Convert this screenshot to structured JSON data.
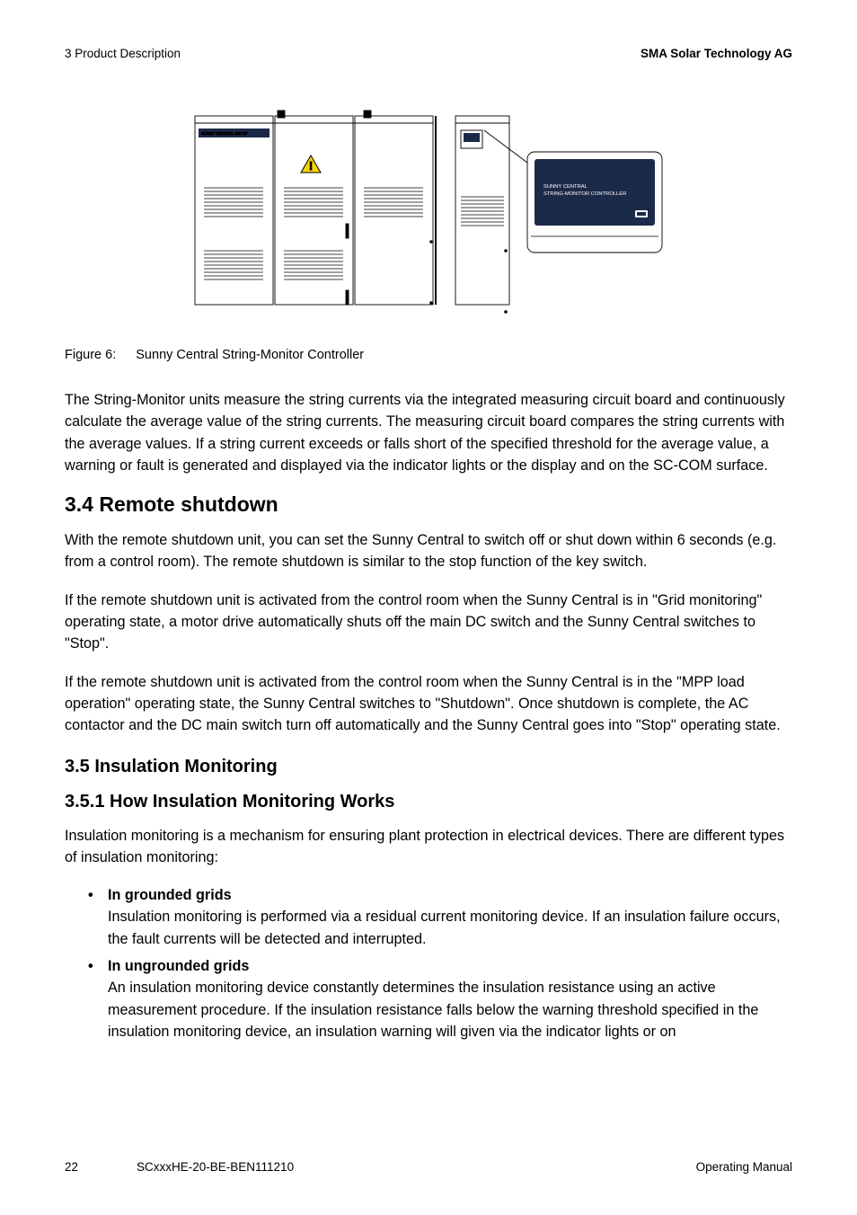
{
  "header": {
    "left": "3  Product Description",
    "right": "SMA Solar Technology AG"
  },
  "figure": {
    "cab_label": "SUNNY CENTRAL 800 CP",
    "ctrl_line1": "SUNNY CENTRAL",
    "ctrl_line2": "STRING-MONITOR CONTROLLER",
    "caption_label": "Figure 6:",
    "caption_text": "Sunny Central String-Monitor Controller"
  },
  "paragraphs": {
    "p1": "The String-Monitor units measure the string currents via the integrated measuring circuit board and continuously calculate the average value of the string currents. The measuring circuit board compares the string currents with the average values. If a string current exceeds or falls short of the specified threshold for the average value, a warning or fault is generated and displayed via the indicator lights or the display and on the SC-COM surface.",
    "p2": "With the remote shutdown unit, you can set the Sunny Central to switch off or shut down within 6 seconds (e.g. from a control room). The remote shutdown is similar to the stop function of the key switch.",
    "p3": "If the remote shutdown unit is activated from the control room when the Sunny Central is in \"Grid monitoring\" operating state, a motor drive automatically shuts off the main DC switch and the Sunny Central switches to \"Stop\".",
    "p4": "If the remote shutdown unit is activated from the control room when the Sunny Central is in the \"MPP load operation\" operating state, the Sunny Central switches to \"Shutdown\". Once shutdown is complete, the AC contactor and the DC main switch turn off automatically and the Sunny Central goes into \"Stop\" operating state.",
    "p5": "Insulation monitoring is a mechanism for ensuring plant protection in electrical devices. There are different types of insulation monitoring:"
  },
  "headings": {
    "h34": "3.4  Remote shutdown",
    "h35": "3.5  Insulation Monitoring",
    "h351": "3.5.1  How Insulation Monitoring Works"
  },
  "bullets": {
    "b1_title": "In grounded grids",
    "b1_body": "Insulation monitoring is performed via a residual current monitoring device. If an insulation failure occurs, the fault currents will be detected and interrupted.",
    "b2_title": "In ungrounded grids",
    "b2_body": "An insulation monitoring device constantly determines the insulation resistance using an active measurement procedure. If the insulation resistance falls below the warning threshold specified in the insulation monitoring device, an insulation warning will given via the indicator lights or on"
  },
  "footer": {
    "page": "22",
    "doc": "SCxxxHE-20-BE-BEN111210",
    "label": "Operating Manual"
  }
}
